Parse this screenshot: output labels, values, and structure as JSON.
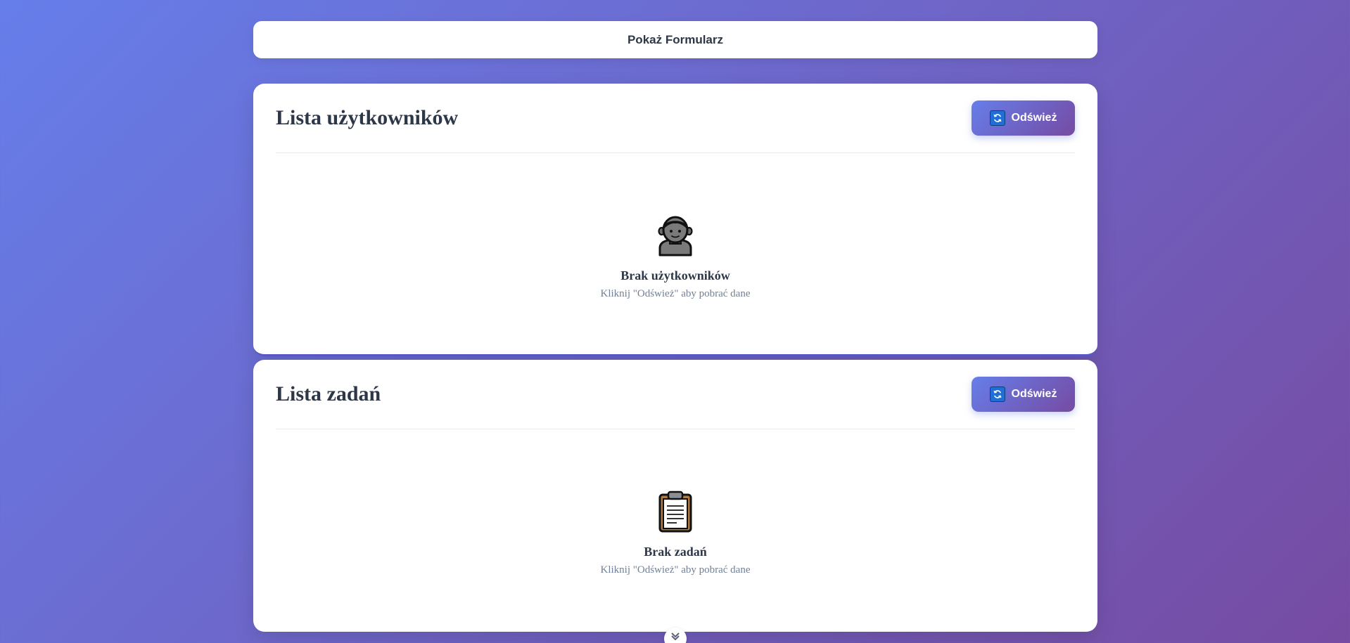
{
  "toggle": {
    "label": "Pokaż Formularz"
  },
  "users": {
    "title": "Lista użytkowników",
    "refresh_label": "Odśwież",
    "refresh_icon": "refresh-icon",
    "empty_icon": "person-icon",
    "empty_title": "Brak użytkowników",
    "empty_subtitle": "Kliknij \"Odśwież\" aby pobrać dane"
  },
  "tasks": {
    "title": "Lista zadań",
    "refresh_label": "Odśwież",
    "refresh_icon": "refresh-icon",
    "empty_icon": "clipboard-icon",
    "empty_title": "Brak zadań",
    "empty_subtitle": "Kliknij \"Odśwież\" aby pobrać dane"
  },
  "scroll": {
    "icon": "chevron-down-icon"
  },
  "colors": {
    "gradient_start": "#667eea",
    "gradient_end": "#764ba2",
    "text_dark": "#2d3748",
    "text_muted": "#718096"
  }
}
